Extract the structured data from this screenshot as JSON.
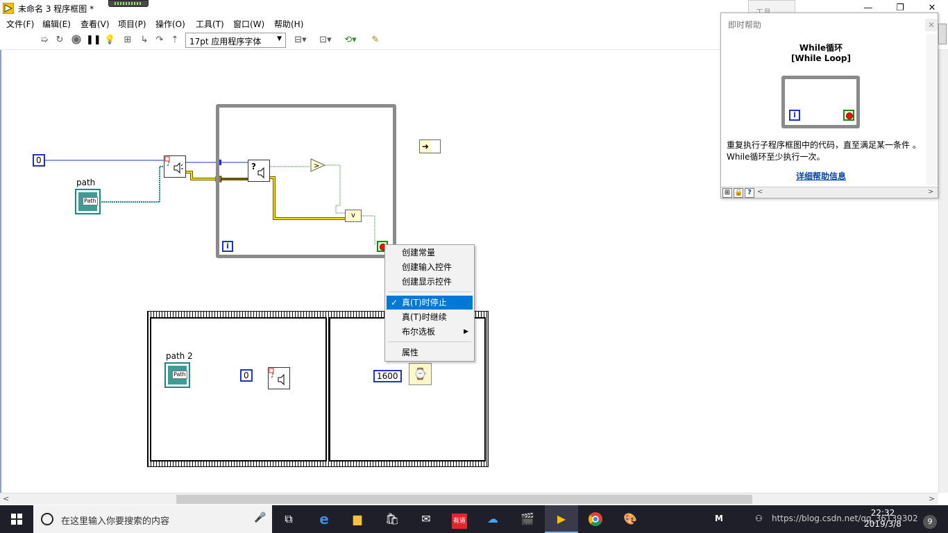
{
  "window": {
    "title": "未命名 3 程序框图 *",
    "ghost_tab": "工具"
  },
  "menu": [
    "文件(F)",
    "编辑(E)",
    "查看(V)",
    "项目(P)",
    "操作(O)",
    "工具(T)",
    "窗口(W)",
    "帮助(H)"
  ],
  "toolbar": {
    "font": "17pt 应用程序字体",
    "icons": [
      "run-arrow-icon",
      "run-continuous-icon",
      "abort-icon",
      "pause-icon",
      "highlight-execution-icon",
      "retain-wire-values-icon",
      "step-into-icon",
      "step-over-icon",
      "step-out-icon",
      "align-icon",
      "distribute-icon",
      "reorder-icon",
      "cleanup-icon"
    ]
  },
  "diagram": {
    "const_zero_left": "0",
    "path_label": "path",
    "path_text": "Path",
    "path2_label": "path 2",
    "const_zero_seq": "0",
    "const_1600": "1600",
    "iter_label": "i",
    "select_label": "v",
    "cmp_symbol": ">"
  },
  "context_menu": {
    "items": [
      "创建常量",
      "创建输入控件",
      "创建显示控件"
    ],
    "options": [
      "真(T)时停止",
      "真(T)时继续",
      "布尔选板"
    ],
    "properties": "属性",
    "checked": "真(T)时停止",
    "check_mark": "✓"
  },
  "help": {
    "title": "即时帮助",
    "heading_cn": "While循环",
    "heading_en": "[While Loop]",
    "description": "重复执行子程序框图中的代码，直至满足某一条件 。 While循环至少执行一次。",
    "link": "详细帮助信息",
    "iter_label": "i"
  },
  "taskbar": {
    "search_placeholder": "在这里输入你要搜索的内容",
    "time": "22:32",
    "date": "2019/3/8",
    "watermark": "https://blog.csdn.net/qq_36139302",
    "ime": "M",
    "notif_count": "9"
  }
}
